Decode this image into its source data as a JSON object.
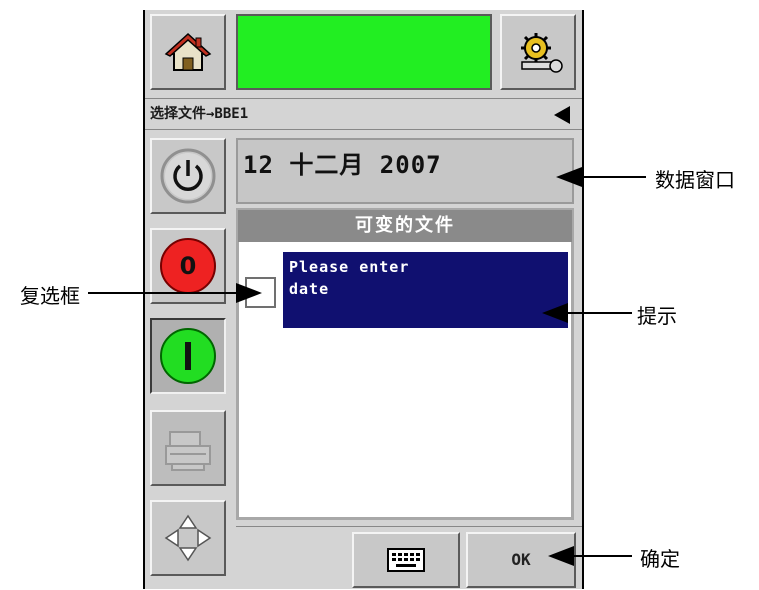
{
  "breadcrumb": "选择文件→BBE1",
  "date_window": {
    "value": "12 十二月 2007"
  },
  "panel": {
    "title": "可变的文件"
  },
  "prompt": {
    "text": "Please enter\ndate"
  },
  "bottom": {
    "ok_label": "OK"
  },
  "annotations": {
    "data_window": "数据窗口",
    "checkbox": "复选框",
    "prompt": "提示",
    "confirm": "确定"
  },
  "icons": [
    "home-icon",
    "settings-gear-icon",
    "back-arrow-icon",
    "power-icon",
    "stop-icon",
    "start-icon",
    "printer-icon",
    "navigation-arrows-icon",
    "keyboard-icon"
  ],
  "colors": {
    "status": "#22ee22",
    "stop": "#ee2222",
    "start": "#22dd22",
    "prompt_bg": "#101070"
  }
}
